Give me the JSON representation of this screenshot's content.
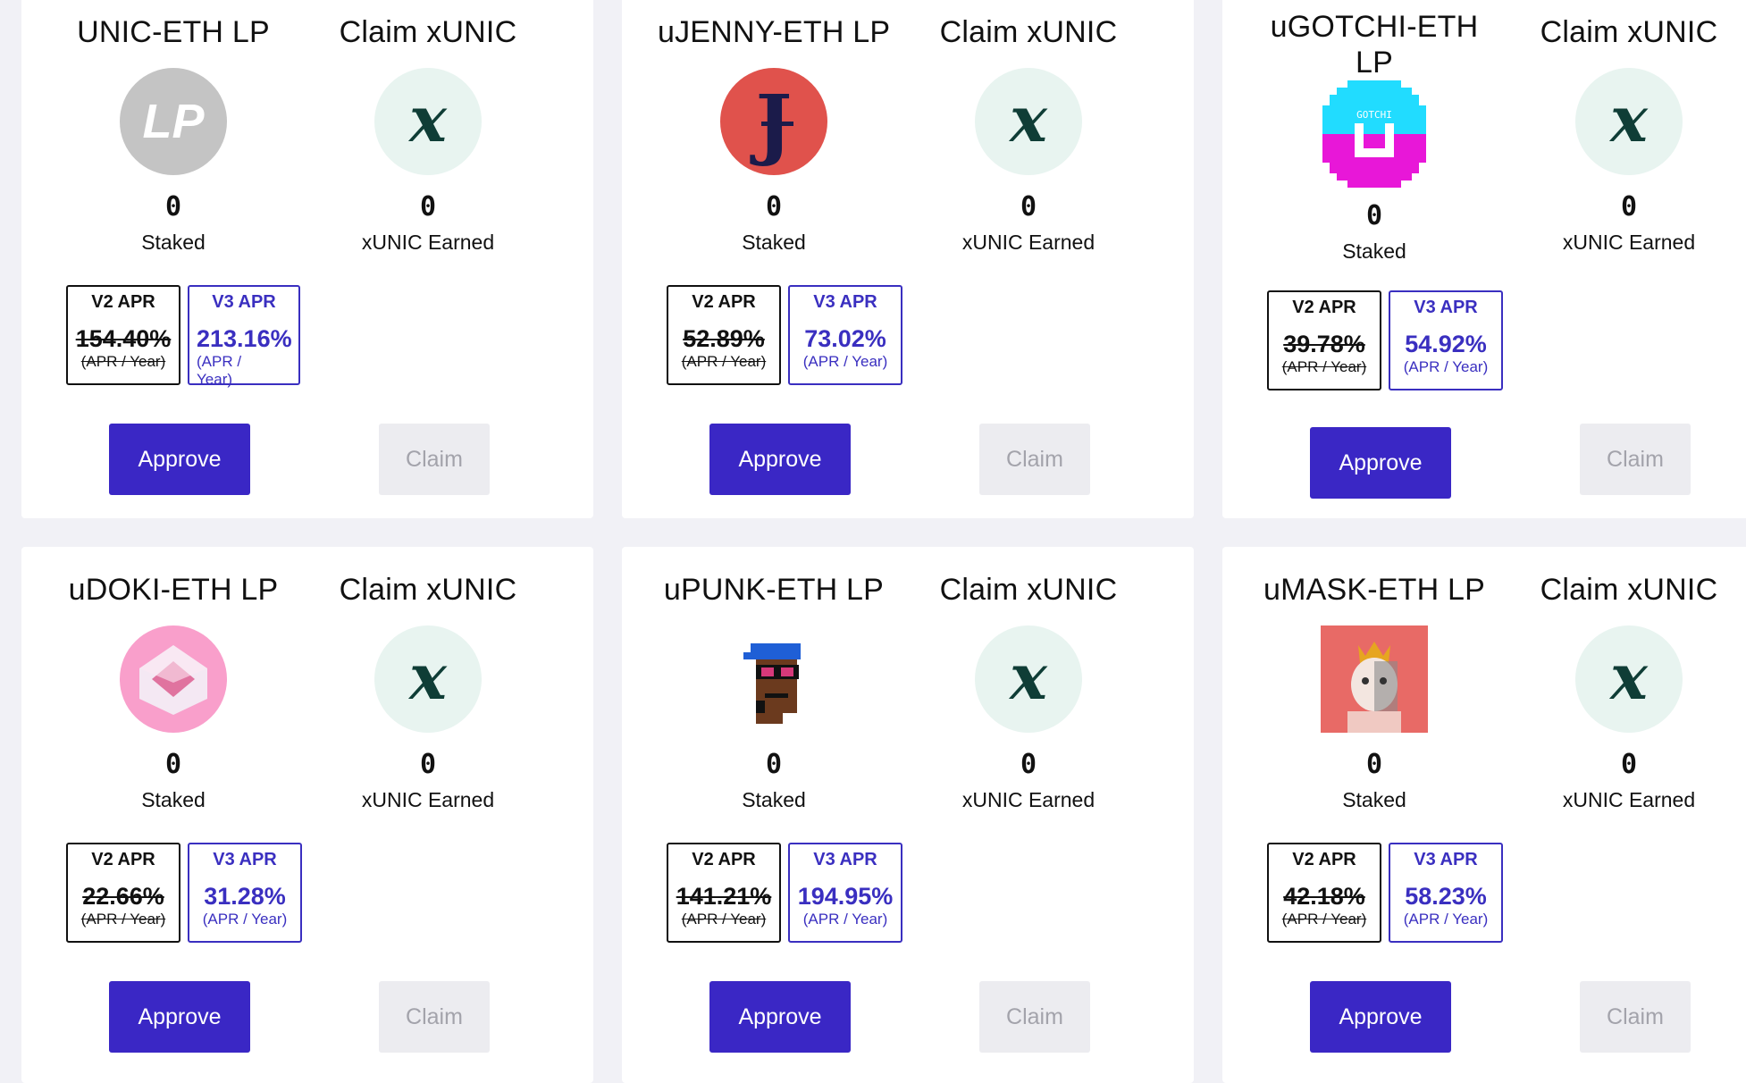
{
  "cards": [
    {
      "pool_title": "UNIC-ETH LP",
      "claim_title": "Claim xUNIC",
      "staked_value": "0",
      "staked_label": "Staked",
      "earned_value": "0",
      "earned_label": "xUNIC Earned",
      "v2_header": "V2 APR",
      "v2_percent": "154.40%",
      "v2_unit": "(APR / Year)",
      "v3_header": "V3 APR",
      "v3_percent": "213.16%",
      "v3_unit": "(APR / Year)",
      "approve_label": "Approve",
      "claim_label": "Claim",
      "logo_icon": "lp-token-icon",
      "logo_color": "#c4c4c4"
    },
    {
      "pool_title": "uJENNY-ETH LP",
      "claim_title": "Claim xUNIC",
      "staked_value": "0",
      "staked_label": "Staked",
      "earned_value": "0",
      "earned_label": "xUNIC Earned",
      "v2_header": "V2 APR",
      "v2_percent": "52.89%",
      "v2_unit": "(APR / Year)",
      "v3_header": "V3 APR",
      "v3_percent": "73.02%",
      "v3_unit": "(APR / Year)",
      "approve_label": "Approve",
      "claim_label": "Claim",
      "logo_icon": "jenny-icon",
      "logo_color": "#e0524c"
    },
    {
      "pool_title": "uGOTCHI-ETH LP",
      "claim_title": "Claim xUNIC",
      "staked_value": "0",
      "staked_label": "Staked",
      "earned_value": "0",
      "earned_label": "xUNIC Earned",
      "v2_header": "V2 APR",
      "v2_percent": "39.78%",
      "v2_unit": "(APR / Year)",
      "v3_header": "V3 APR",
      "v3_percent": "54.92%",
      "v3_unit": "(APR / Year)",
      "approve_label": "Approve",
      "claim_label": "Claim",
      "logo_icon": "gotchi-icon",
      "logo_color": "#21dcff",
      "logo_text": "GOTCHI"
    },
    {
      "pool_title": "uDOKI-ETH LP",
      "claim_title": "Claim xUNIC",
      "staked_value": "0",
      "staked_label": "Staked",
      "earned_value": "0",
      "earned_label": "xUNIC Earned",
      "v2_header": "V2 APR",
      "v2_percent": "22.66%",
      "v2_unit": "(APR / Year)",
      "v3_header": "V3 APR",
      "v3_percent": "31.28%",
      "v3_unit": "(APR / Year)",
      "approve_label": "Approve",
      "claim_label": "Claim",
      "logo_icon": "doki-icon",
      "logo_color": "#f99fcb"
    },
    {
      "pool_title": "uPUNK-ETH LP",
      "claim_title": "Claim xUNIC",
      "staked_value": "0",
      "staked_label": "Staked",
      "earned_value": "0",
      "earned_label": "xUNIC Earned",
      "v2_header": "V2 APR",
      "v2_percent": "141.21%",
      "v2_unit": "(APR / Year)",
      "v3_header": "V3 APR",
      "v3_percent": "194.95%",
      "v3_unit": "(APR / Year)",
      "approve_label": "Approve",
      "claim_label": "Claim",
      "logo_icon": "punk-icon",
      "logo_color": "#ffffff"
    },
    {
      "pool_title": "uMASK-ETH LP",
      "claim_title": "Claim xUNIC",
      "staked_value": "0",
      "staked_label": "Staked",
      "earned_value": "0",
      "earned_label": "xUNIC Earned",
      "v2_header": "V2 APR",
      "v2_percent": "42.18%",
      "v2_unit": "(APR / Year)",
      "v3_header": "V3 APR",
      "v3_percent": "58.23%",
      "v3_unit": "(APR / Year)",
      "approve_label": "Approve",
      "claim_label": "Claim",
      "logo_icon": "mask-icon",
      "logo_color": "#e86a66"
    }
  ],
  "colors": {
    "accent": "#3a27c5",
    "claim_disabled_bg": "#ececf0",
    "xunic_circle": "#e8f4f0",
    "xunic_glyph": "#0f3d36"
  },
  "xunic_icon": "x-icon"
}
